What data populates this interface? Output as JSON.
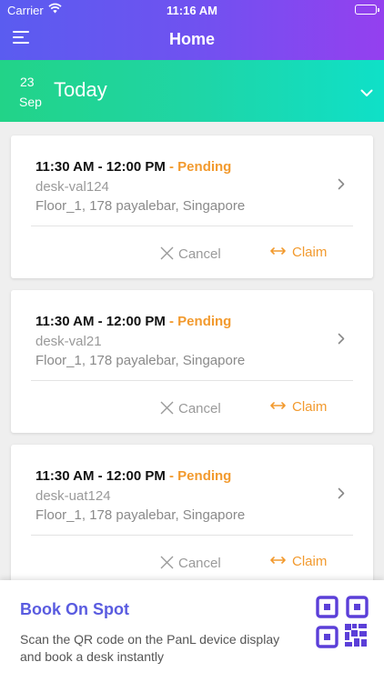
{
  "status_bar": {
    "carrier": "Carrier",
    "time": "11:16 AM"
  },
  "header": {
    "title": "Home"
  },
  "date_bar": {
    "day": "23",
    "month": "Sep",
    "label": "Today"
  },
  "bookings": [
    {
      "time": "11:30 AM - 12:00 PM",
      "status": "- Pending",
      "desk": "desk-val124",
      "location": "Floor_1, 178 payalebar, Singapore",
      "cancel_label": "Cancel",
      "claim_label": "Claim"
    },
    {
      "time": "11:30 AM - 12:00 PM",
      "status": "- Pending",
      "desk": "desk-val21",
      "location": "Floor_1, 178 payalebar, Singapore",
      "cancel_label": "Cancel",
      "claim_label": "Claim"
    },
    {
      "time": "11:30 AM - 12:00 PM",
      "status": "- Pending",
      "desk": "desk-uat124",
      "location": "Floor_1, 178 payalebar, Singapore",
      "cancel_label": "Cancel",
      "claim_label": "Claim"
    }
  ],
  "book_on_spot": {
    "title": "Book On Spot",
    "description": "Scan the QR code on the PanL device display and book a desk instantly",
    "icon": "qr-code-icon"
  },
  "colors": {
    "header_gradient": [
      "#5a5cf0",
      "#9440ef"
    ],
    "date_gradient": [
      "#22d388",
      "#0fe0c8"
    ],
    "pending": "#f29a2e",
    "claim": "#f29a2e",
    "accent_purple": "#5a5ce0"
  }
}
